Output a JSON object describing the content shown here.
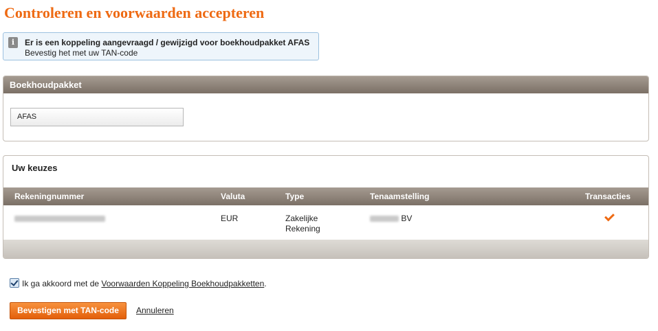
{
  "page": {
    "title": "Controleren en voorwaarden accepteren"
  },
  "notice": {
    "icon": "info-icon",
    "line1": "Er is een koppeling aangevraagd / gewijzigd voor boekhoudpakket AFAS",
    "line2": "Bevestig het met uw TAN-code"
  },
  "package_panel": {
    "heading": "Boekhoudpakket",
    "value": "AFAS"
  },
  "choices_panel": {
    "heading": "Uw keuzes",
    "columns": [
      "Rekeningnummer",
      "Valuta",
      "Type",
      "Tenaamstelling",
      "Transacties"
    ],
    "row": {
      "valuta": "EUR",
      "type_line1": "Zakelijke",
      "type_line2": "Rekening",
      "tenaamstelling_suffix": "BV",
      "transacties_icon": "checkmark-icon"
    }
  },
  "agreement": {
    "prefix": "Ik ga akkoord met de",
    "link": "Voorwaarden Koppeling Boekhoudpakketten",
    "suffix": ".",
    "checked": true
  },
  "actions": {
    "confirm": "Bevestigen met TAN-code",
    "cancel": "Annuleren"
  },
  "colors": {
    "accent": "#ee6a13",
    "header_bar": "#8f847a",
    "notice_border": "#9cc0df"
  }
}
